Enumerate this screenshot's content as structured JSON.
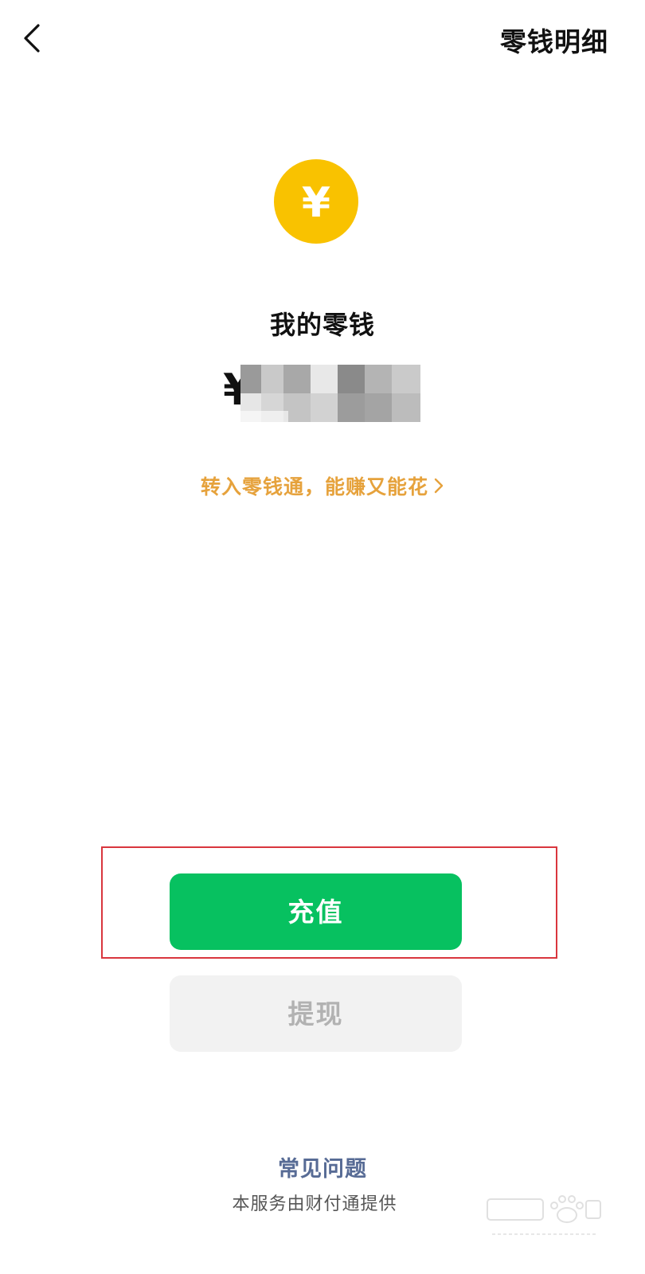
{
  "header": {
    "right_link": "零钱明细"
  },
  "wallet": {
    "label": "我的零钱",
    "currency_symbol": "¥",
    "coin_symbol": "¥"
  },
  "promo": {
    "text": "转入零钱通，能赚又能花"
  },
  "actions": {
    "recharge_label": "充值",
    "withdraw_label": "提现"
  },
  "footer": {
    "faq_label": "常见问题",
    "provider_note": "本服务由财付通提供"
  },
  "colors": {
    "coin": "#f9c200",
    "primary_button": "#07c160",
    "promo_text": "#e6a23c",
    "faq_link": "#576b95",
    "highlight_border": "#d9363e"
  },
  "icons": {
    "back": "chevron-left-icon",
    "coin": "yen-coin-icon",
    "promo_arrow": "chevron-right-icon"
  }
}
